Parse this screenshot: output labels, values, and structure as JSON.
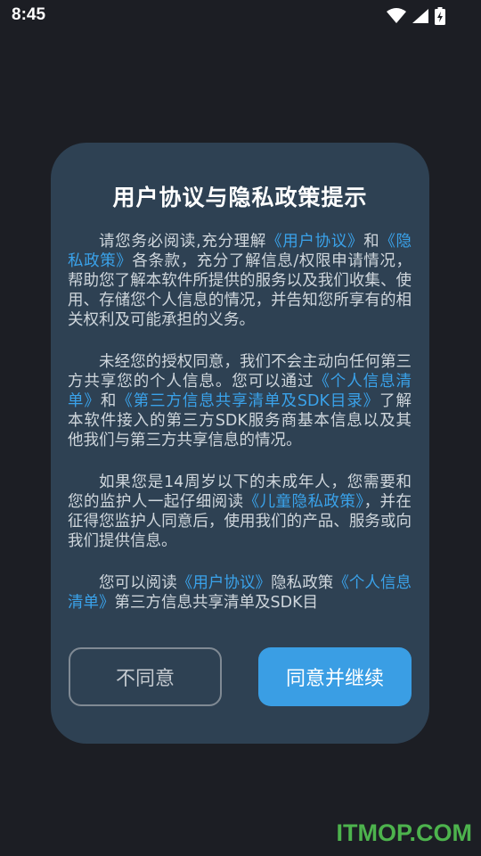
{
  "status_bar": {
    "time": "8:45",
    "icons": [
      "wifi-icon",
      "signal-icon",
      "battery-charging-icon"
    ]
  },
  "dialog": {
    "title": "用户协议与隐私政策提示",
    "paragraphs": [
      [
        {
          "text": "请您务必阅读,充分理解",
          "link": false
        },
        {
          "text": "《用户协议》",
          "link": true
        },
        {
          "text": "和",
          "link": false
        },
        {
          "text": "《隐私政策》",
          "link": true
        },
        {
          "text": "各条款，充分了解信息/权限申请情况，帮助您了解本软件所提供的服务以及我们收集、使用、存储您个人信息的情况，并告知您所享有的相关权利及可能承担的义务。",
          "link": false
        }
      ],
      [
        {
          "text": "未经您的授权同意，我们不会主动向任何第三方共享您的个人信息。您可以通过",
          "link": false
        },
        {
          "text": "《个人信息清单》",
          "link": true
        },
        {
          "text": "和",
          "link": false
        },
        {
          "text": "《第三方信息共享清单及SDK目录》",
          "link": true
        },
        {
          "text": "了解本软件接入的第三方SDK服务商基本信息以及其他我们与第三方共享信息的情况。",
          "link": false
        }
      ],
      [
        {
          "text": "如果您是14周岁以下的未成年人，您需要和您的监护人一起仔细阅读",
          "link": false
        },
        {
          "text": "《儿童隐私政策》",
          "link": true
        },
        {
          "text": "，并在征得您监护人同意后，使用我们的产品、服务或向我们提供信息。",
          "link": false
        }
      ],
      [
        {
          "text": "您可以阅读",
          "link": false
        },
        {
          "text": "《用户协议》",
          "link": true
        },
        {
          "text": "隐私政策",
          "link": false
        },
        {
          "text": "《个人信息清单》",
          "link": true
        },
        {
          "text": "第三方信息共享清单及SDK目",
          "link": false
        }
      ]
    ],
    "disagree_label": "不同意",
    "agree_label": "同意并继续"
  },
  "watermark": "ITMOP.COM",
  "colors": {
    "background": "#1c1e24",
    "dialog": "#2e4153",
    "link": "#3aa2ea",
    "primary_button": "#3a9ee4",
    "watermark": "#4db34d"
  }
}
